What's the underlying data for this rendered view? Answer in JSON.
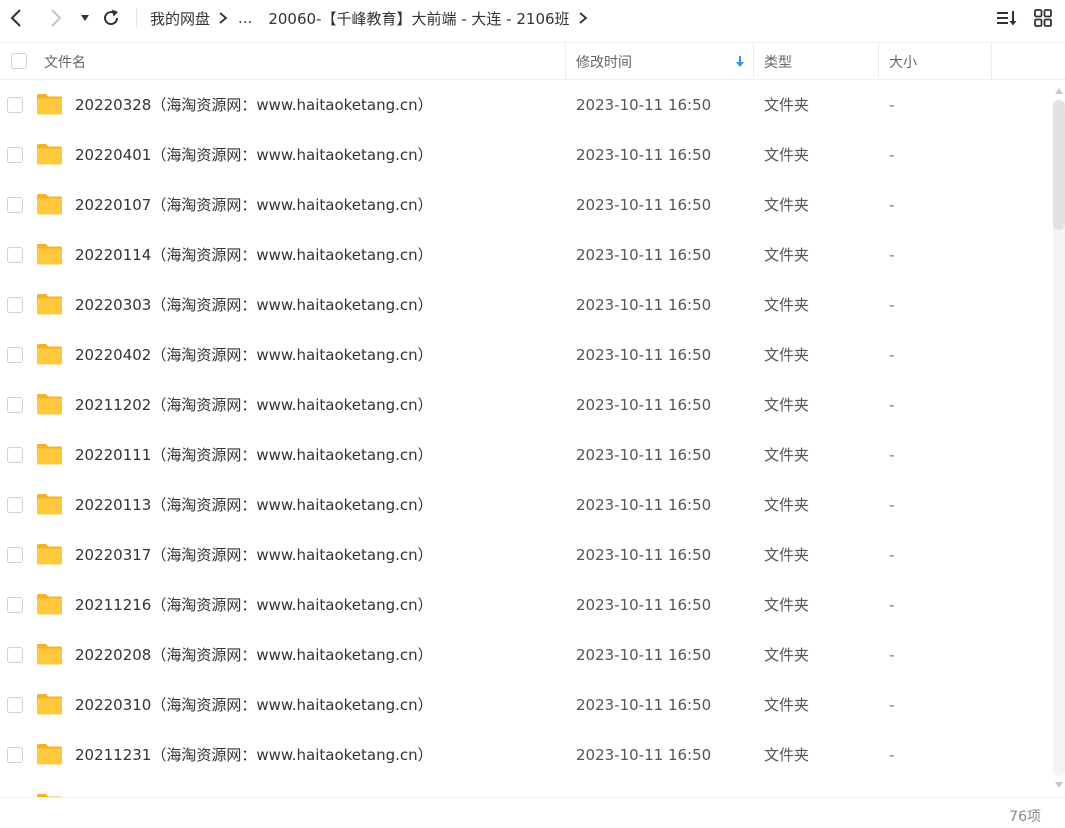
{
  "toolbar": {
    "breadcrumb": [
      "我的网盘",
      "...",
      "20060-【千峰教育】大前端 - 大连 - 2106班"
    ]
  },
  "header": {
    "name": "文件名",
    "modified": "修改时间",
    "type": "类型",
    "size": "大小"
  },
  "files": [
    {
      "name": "20220328（海淘资源网：www.haitaoketang.cn）",
      "modified": "2023-10-11 16:50",
      "type": "文件夹",
      "size": "-"
    },
    {
      "name": "20220401（海淘资源网：www.haitaoketang.cn）",
      "modified": "2023-10-11 16:50",
      "type": "文件夹",
      "size": "-"
    },
    {
      "name": "20220107（海淘资源网：www.haitaoketang.cn）",
      "modified": "2023-10-11 16:50",
      "type": "文件夹",
      "size": "-"
    },
    {
      "name": "20220114（海淘资源网：www.haitaoketang.cn）",
      "modified": "2023-10-11 16:50",
      "type": "文件夹",
      "size": "-"
    },
    {
      "name": "20220303（海淘资源网：www.haitaoketang.cn）",
      "modified": "2023-10-11 16:50",
      "type": "文件夹",
      "size": "-"
    },
    {
      "name": "20220402（海淘资源网：www.haitaoketang.cn）",
      "modified": "2023-10-11 16:50",
      "type": "文件夹",
      "size": "-"
    },
    {
      "name": "20211202（海淘资源网：www.haitaoketang.cn）",
      "modified": "2023-10-11 16:50",
      "type": "文件夹",
      "size": "-"
    },
    {
      "name": "20220111（海淘资源网：www.haitaoketang.cn）",
      "modified": "2023-10-11 16:50",
      "type": "文件夹",
      "size": "-"
    },
    {
      "name": "20220113（海淘资源网：www.haitaoketang.cn）",
      "modified": "2023-10-11 16:50",
      "type": "文件夹",
      "size": "-"
    },
    {
      "name": "20220317（海淘资源网：www.haitaoketang.cn）",
      "modified": "2023-10-11 16:50",
      "type": "文件夹",
      "size": "-"
    },
    {
      "name": "20211216（海淘资源网：www.haitaoketang.cn）",
      "modified": "2023-10-11 16:50",
      "type": "文件夹",
      "size": "-"
    },
    {
      "name": "20220208（海淘资源网：www.haitaoketang.cn）",
      "modified": "2023-10-11 16:50",
      "type": "文件夹",
      "size": "-"
    },
    {
      "name": "20220310（海淘资源网：www.haitaoketang.cn）",
      "modified": "2023-10-11 16:50",
      "type": "文件夹",
      "size": "-"
    },
    {
      "name": "20211231（海淘资源网：www.haitaoketang.cn）",
      "modified": "2023-10-11 16:50",
      "type": "文件夹",
      "size": "-"
    }
  ],
  "status": {
    "count": "76项"
  },
  "colors": {
    "folder": "#FFC83D",
    "folder_back": "#F5B324",
    "sort_arrow": "#3B8CF5",
    "border": "#EEEEEE"
  },
  "icons": {
    "back": "chevron-left-icon",
    "forward": "chevron-right-icon",
    "history": "caret-down-icon",
    "refresh": "refresh-icon",
    "sort_view": "sort-list-icon",
    "grid_view": "grid-icon",
    "folder": "folder-icon",
    "sort_direction": "arrow-down-icon"
  }
}
